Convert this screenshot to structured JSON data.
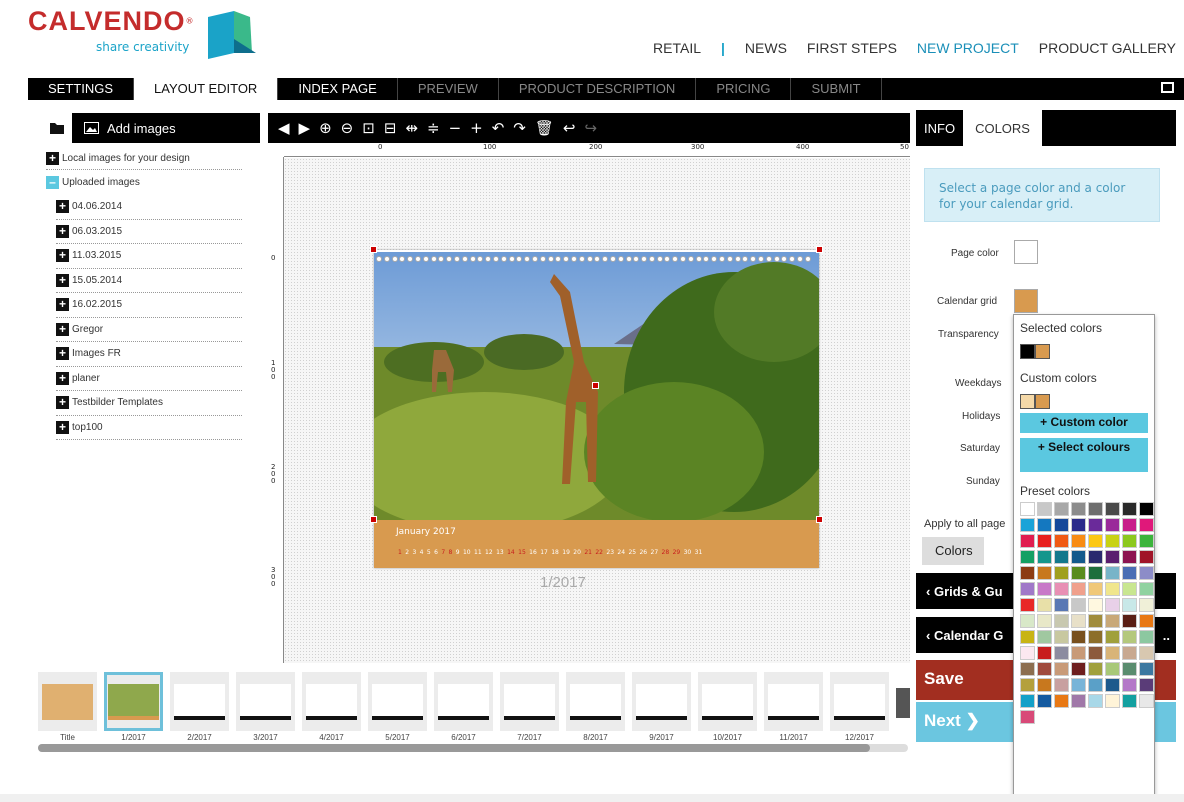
{
  "brand": {
    "name": "CALVENDO",
    "reg": "®",
    "tagline": "share creativity"
  },
  "topnav": {
    "retail": "RETAIL",
    "sep": "|",
    "news": "NEWS",
    "first_steps": "FIRST STEPS",
    "new_project": "NEW PROJECT",
    "gallery": "PRODUCT GALLERY"
  },
  "tabs": [
    "SETTINGS",
    "LAYOUT EDITOR",
    "INDEX PAGE",
    "PREVIEW",
    "PRODUCT DESCRIPTION",
    "PRICING",
    "SUBMIT"
  ],
  "left": {
    "add_images": "Add images",
    "local": "Local images for your design",
    "uploaded": "Uploaded images",
    "folders": [
      "04.06.2014",
      "06.03.2015",
      "11.03.2015",
      "15.05.2014",
      "16.02.2015",
      "Gregor",
      "Images FR",
      "planer",
      "Testbilder Templates",
      "top100"
    ]
  },
  "ruler": {
    "h": [
      "0",
      "100",
      "200",
      "300",
      "400",
      "50"
    ],
    "v": [
      "0",
      "1\n0\n0",
      "2\n0\n0",
      "3\n0\n0"
    ]
  },
  "calendar": {
    "month": "January 2017",
    "page_label": "1/2017",
    "days": [
      "1",
      "2",
      "3",
      "4",
      "5",
      "6",
      "7",
      "8",
      "9",
      "10",
      "11",
      "12",
      "13",
      "14",
      "15",
      "16",
      "17",
      "18",
      "19",
      "20",
      "21",
      "22",
      "23",
      "24",
      "25",
      "26",
      "27",
      "28",
      "29",
      "30",
      "31"
    ]
  },
  "thumbs": [
    "Title",
    "1/2017",
    "2/2017",
    "3/2017",
    "4/2017",
    "5/2017",
    "6/2017",
    "7/2017",
    "8/2017",
    "9/2017",
    "10/2017",
    "11/2017",
    "12/2017"
  ],
  "right": {
    "info_tab": "INFO",
    "colors_tab": "COLORS",
    "info_text": "Select a page color and a color for your calendar grid.",
    "page_color": "Page color",
    "calendar_grid": "Calendar grid",
    "transparency": "Transparency",
    "weekdays": "Weekdays",
    "holidays": "Holidays",
    "saturday": "Saturday",
    "sunday": "Sunday",
    "apply": "Apply to all page",
    "colors_btn": "Colors",
    "grids": "Grids & Gu",
    "calendar_g": "Calendar G",
    "calendar_g_tail": "..",
    "save": "Save",
    "next": "Next",
    "page_color_val": "#ffffff",
    "grid_color_val": "#d89a4f"
  },
  "popup": {
    "selected": "Selected colors",
    "custom": "Custom colors",
    "custom_btn": "+ Custom color",
    "select_btn": "+ Select colours",
    "preset": "Preset colors",
    "selected_colors": [
      "#000000",
      "#d89a4f"
    ],
    "custom_colors": [
      "#f5d9a8",
      "#d89a4f"
    ],
    "preset_colors": [
      "#ffffff",
      "#c8c8c8",
      "#a8a8a8",
      "#8c8c8c",
      "#6e6e6e",
      "#4a4a4a",
      "#2a2a2a",
      "#000000",
      "#1aa3d8",
      "#1478c0",
      "#16489a",
      "#2a2a8a",
      "#6a2a9a",
      "#9a2a9a",
      "#c81e8a",
      "#e0187a",
      "#e01e50",
      "#e8201e",
      "#f05a14",
      "#f88c14",
      "#fcc814",
      "#c8d214",
      "#8cc81e",
      "#3cb43c",
      "#14a064",
      "#14968c",
      "#14788c",
      "#145a8c",
      "#2a2a6e",
      "#5a1e6e",
      "#8c1450",
      "#a01428",
      "#8c3c14",
      "#c8781e",
      "#a0a01e",
      "#5a8c1e",
      "#1e6e3c",
      "#78b4c8",
      "#4a6eb4",
      "#8c8cc8",
      "#a078c8",
      "#c878c8",
      "#e890b4",
      "#f0a08c",
      "#f0c878",
      "#f0e68c",
      "#c8e690",
      "#90d2a0",
      "#e82828",
      "#e8e0a8",
      "#5a78b4",
      "#c8c8c8",
      "#fff8e0",
      "#e8d0e8",
      "#c8e8e8",
      "#f0f0d8",
      "#d8e8c8",
      "#e8e8c8",
      "#c8c8b0",
      "#e8e0c8",
      "#a08c3c",
      "#c8a878",
      "#5a1e14",
      "#e87814",
      "#c8b414",
      "#a0c8a0",
      "#c8c8a0",
      "#78501e",
      "#8c6e2a",
      "#a0a03c",
      "#b4c87c",
      "#8cc8a0",
      "#fce8f0",
      "#c81e1e",
      "#8c8ca0",
      "#c89a78",
      "#8c5a3c",
      "#d8b478",
      "#c8a890",
      "#d8c8b0",
      "#8c6e50",
      "#a04a3c",
      "#c89a78",
      "#6e1e1e",
      "#a0a03c",
      "#a8c878",
      "#5a8c6e",
      "#3c78a0",
      "#b4a03c",
      "#c8781e",
      "#c8a0a0",
      "#78b4d8",
      "#5aa0c8",
      "#1e5a8c",
      "#b478c8",
      "#5a3c78",
      "#14a0c8",
      "#145aa0",
      "#e87814",
      "#a078a8",
      "#a8d8e8",
      "#fff4d8",
      "#14a0a0",
      "#e8e8e8",
      "#d84a78"
    ]
  },
  "canvas": {
    "selection_color": "#c00000"
  }
}
